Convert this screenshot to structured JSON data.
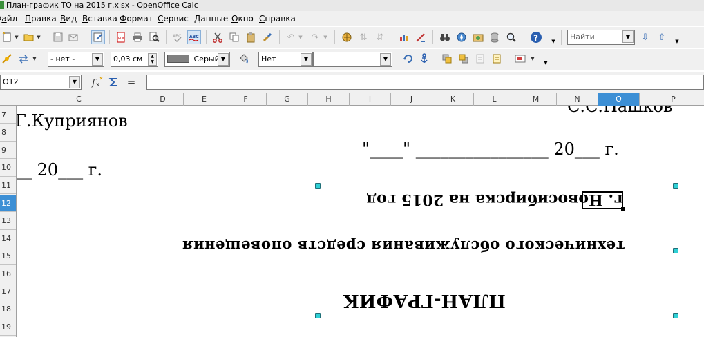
{
  "window": {
    "title": "План-график ТО на 2015  г.xlsx - OpenOffice Calc"
  },
  "menu": [
    {
      "label": "Файл",
      "name": "menu-file"
    },
    {
      "label": "Правка",
      "name": "menu-edit"
    },
    {
      "label": "Вид",
      "name": "menu-view"
    },
    {
      "label": "Вставка",
      "name": "menu-insert"
    },
    {
      "label": "Формат",
      "name": "menu-format"
    },
    {
      "label": "Сервис",
      "name": "menu-tools"
    },
    {
      "label": "Данные",
      "name": "menu-data"
    },
    {
      "label": "Окно",
      "name": "menu-window"
    },
    {
      "label": "Справка",
      "name": "menu-help"
    }
  ],
  "toolbar_standard": {
    "find_placeholder": "Найти",
    "icons": [
      "new-document-icon",
      "open-folder-icon",
      "save-icon",
      "email-icon",
      "edit-file-icon",
      "export-pdf-icon",
      "print-icon",
      "page-preview-icon",
      "spellcheck-icon",
      "autospellcheck-icon",
      "cut-icon",
      "copy-icon",
      "paste-icon",
      "format-paintbrush-icon",
      "undo-icon",
      "redo-icon",
      "hyperlink-icon",
      "sort-ascending-icon",
      "sort-descending-icon",
      "chart-icon",
      "show-draw-functions-icon",
      "find-replace-binoculars-icon",
      "navigator-icon",
      "gallery-icon",
      "data-sources-icon",
      "zoom-icon",
      "help-icon",
      "find-next-icon",
      "find-previous-icon"
    ]
  },
  "toolbar_drawing_object": {
    "line_style_value": "- нет -",
    "line_width_value": "0,03 см",
    "line_color_value": "Серый",
    "area_style_value": "Нет",
    "area_fill_value": "",
    "line_color_swatch": "#808080"
  },
  "formula_bar": {
    "name_box_value": "O12",
    "formula_value": ""
  },
  "columns": [
    {
      "label": "C",
      "selected": false
    },
    {
      "label": "D",
      "selected": false
    },
    {
      "label": "E",
      "selected": false
    },
    {
      "label": "F",
      "selected": false
    },
    {
      "label": "G",
      "selected": false
    },
    {
      "label": "H",
      "selected": false
    },
    {
      "label": "I",
      "selected": false
    },
    {
      "label": "J",
      "selected": false
    },
    {
      "label": "K",
      "selected": false
    },
    {
      "label": "L",
      "selected": false
    },
    {
      "label": "M",
      "selected": false
    },
    {
      "label": "N",
      "selected": false
    },
    {
      "label": "O",
      "selected": true
    },
    {
      "label": "P",
      "selected": false
    }
  ],
  "rows": [
    {
      "label": "7",
      "selected": false
    },
    {
      "label": "8",
      "selected": false
    },
    {
      "label": "9",
      "selected": false
    },
    {
      "label": "10",
      "selected": false
    },
    {
      "label": "11",
      "selected": false
    },
    {
      "label": "12",
      "selected": true
    },
    {
      "label": "13",
      "selected": false
    },
    {
      "label": "14",
      "selected": false
    },
    {
      "label": "15",
      "selected": false
    },
    {
      "label": "16",
      "selected": false
    },
    {
      "label": "17",
      "selected": false
    },
    {
      "label": "18",
      "selected": false
    },
    {
      "label": "19",
      "selected": false
    }
  ],
  "sheet": {
    "top_cut_text": "С.С.Пашков",
    "kupriyanov": "Г.Куприянов",
    "date_right": "\"____\" ________________ 20___ г.",
    "date_left": "__ 20___ г.",
    "flipped_city_line": "г. Новосибирска  на 2015 год",
    "flipped_subtitle": "технического    обслуживания    средств    оповещения",
    "flipped_title": "ПЛАН-ГРАФИК"
  },
  "colors": {
    "selection_blue": "#3c8fd5",
    "handle_cyan": "#2fd0d5",
    "ui_gray": "#f0f0f0"
  }
}
